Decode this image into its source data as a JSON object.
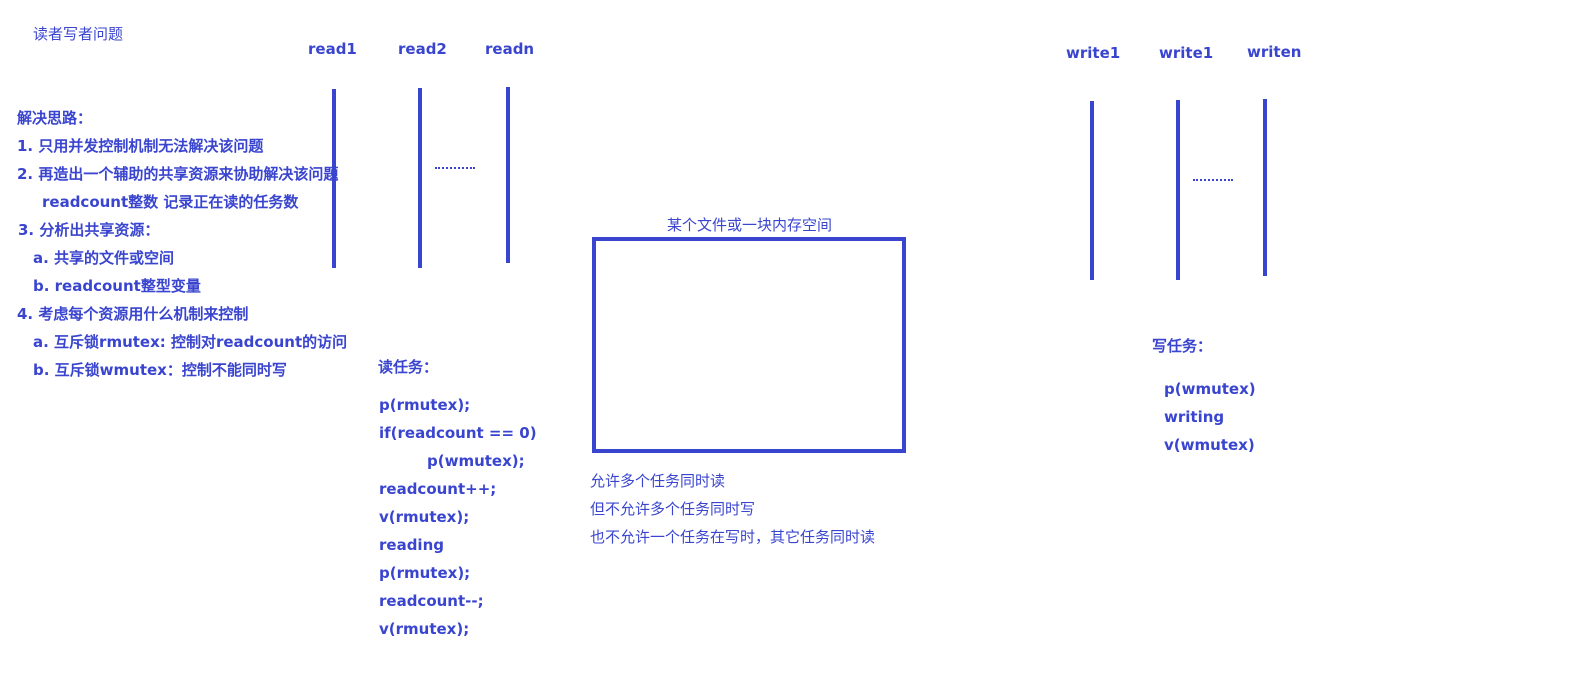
{
  "title": "读者写者问题",
  "approach": {
    "heading": "解决思路：",
    "lines": [
      "1. 只用并发控制机制无法解决该问题",
      "2. 再造出一个辅助的共享资源来协助解决该问题",
      "readcount整数 记录正在读的任务数",
      "3. 分析出共享资源：",
      "a. 共享的文件或空间",
      "b. readcount整型变量",
      "4. 考虑每个资源用什么机制来控制",
      "a.  互斥锁rmutex: 控制对readcount的访问",
      "b.  互斥锁wmutex：控制不能同时写"
    ]
  },
  "readers": [
    "read1",
    "read2",
    "readn"
  ],
  "writers": [
    "write1",
    "write1",
    "writen"
  ],
  "resource": {
    "label": "某个文件或一块内存空间",
    "notes": [
      "允许多个任务同时读",
      "但不允许多个任务同时写",
      "也不允许一个任务在写时，其它任务同时读"
    ]
  },
  "read_task": {
    "heading": "读任务：",
    "code": [
      "p(rmutex);",
      "if(readcount == 0)",
      "p(wmutex);",
      "readcount++;",
      "v(rmutex);",
      "reading",
      "p(rmutex);",
      "readcount--;",
      "v(rmutex);"
    ]
  },
  "write_task": {
    "heading": "写任务：",
    "code": [
      "p(wmutex)",
      "writing",
      "v(wmutex)"
    ]
  }
}
